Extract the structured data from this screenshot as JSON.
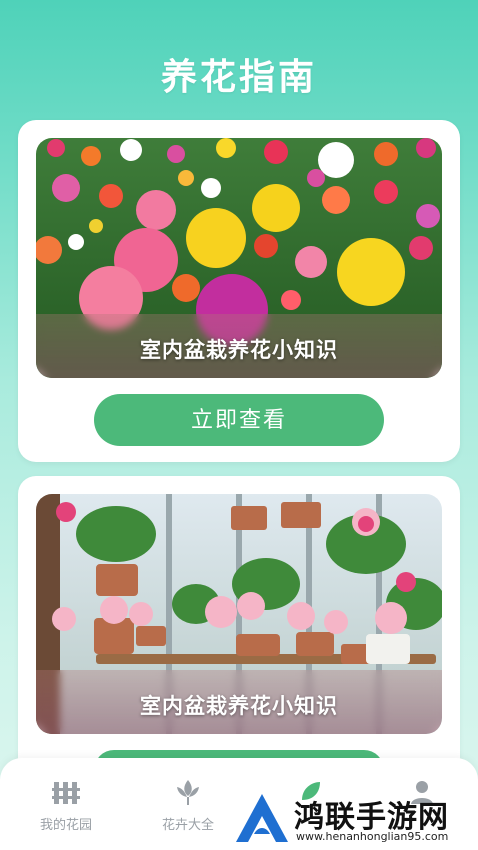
{
  "header": {
    "title": "养花指南"
  },
  "cards": [
    {
      "caption": "室内盆栽养花小知识",
      "button_label": "立即查看",
      "image": "flower-field-photo"
    },
    {
      "caption": "室内盆栽养花小知识",
      "button_label": "",
      "image": "potted-plants-shelf-photo"
    }
  ],
  "tabbar": {
    "items": [
      {
        "label": "我的花园",
        "icon": "garden-fence-icon"
      },
      {
        "label": "花卉大全",
        "icon": "lotus-icon"
      },
      {
        "label": "",
        "icon": "leaf-icon"
      },
      {
        "label": "",
        "icon": "profile-icon"
      }
    ]
  },
  "watermark": {
    "text": "鸿联手游网",
    "url": "www.henanhonglian95.com"
  },
  "colors": {
    "accent": "#4cb97a",
    "background_top": "#4fd2b9",
    "card": "#ffffff"
  }
}
